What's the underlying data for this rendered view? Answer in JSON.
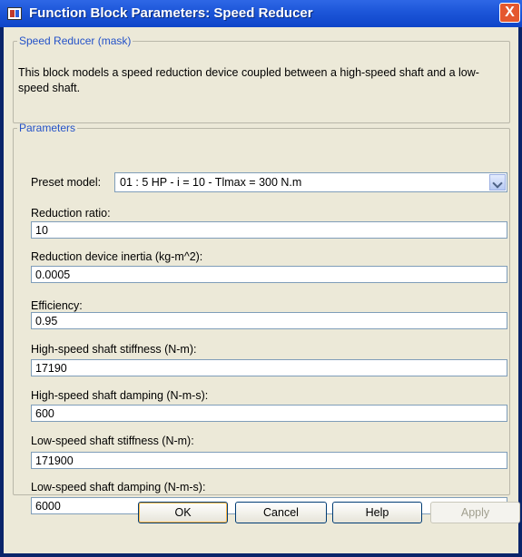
{
  "window": {
    "title": "Function Block Parameters: Speed Reducer",
    "close_glyph": "X",
    "icon": "simulink-block-icon"
  },
  "mask": {
    "group_title": "Speed Reducer (mask)",
    "description": "This block models a speed reduction device coupled between a high-speed shaft and a low-speed shaft."
  },
  "parameters": {
    "group_title": "Parameters",
    "preset_label": "Preset model:",
    "preset_value": "01 : 5 HP - i = 10 - Tlmax = 300 N.m",
    "fields": [
      {
        "label": "Reduction ratio:",
        "value": "10"
      },
      {
        "label": "Reduction device inertia (kg-m^2):",
        "value": "0.0005"
      },
      {
        "label": "Efficiency:",
        "value": "0.95"
      },
      {
        "label": "High-speed shaft stiffness (N-m):",
        "value": "17190"
      },
      {
        "label": "High-speed shaft damping (N-m-s):",
        "value": "600"
      },
      {
        "label": "Low-speed shaft stiffness (N-m):",
        "value": "171900"
      },
      {
        "label": "Low-speed shaft damping (N-m-s):",
        "value": "6000"
      }
    ]
  },
  "buttons": {
    "ok": "OK",
    "cancel": "Cancel",
    "help": "Help",
    "apply": "Apply"
  }
}
